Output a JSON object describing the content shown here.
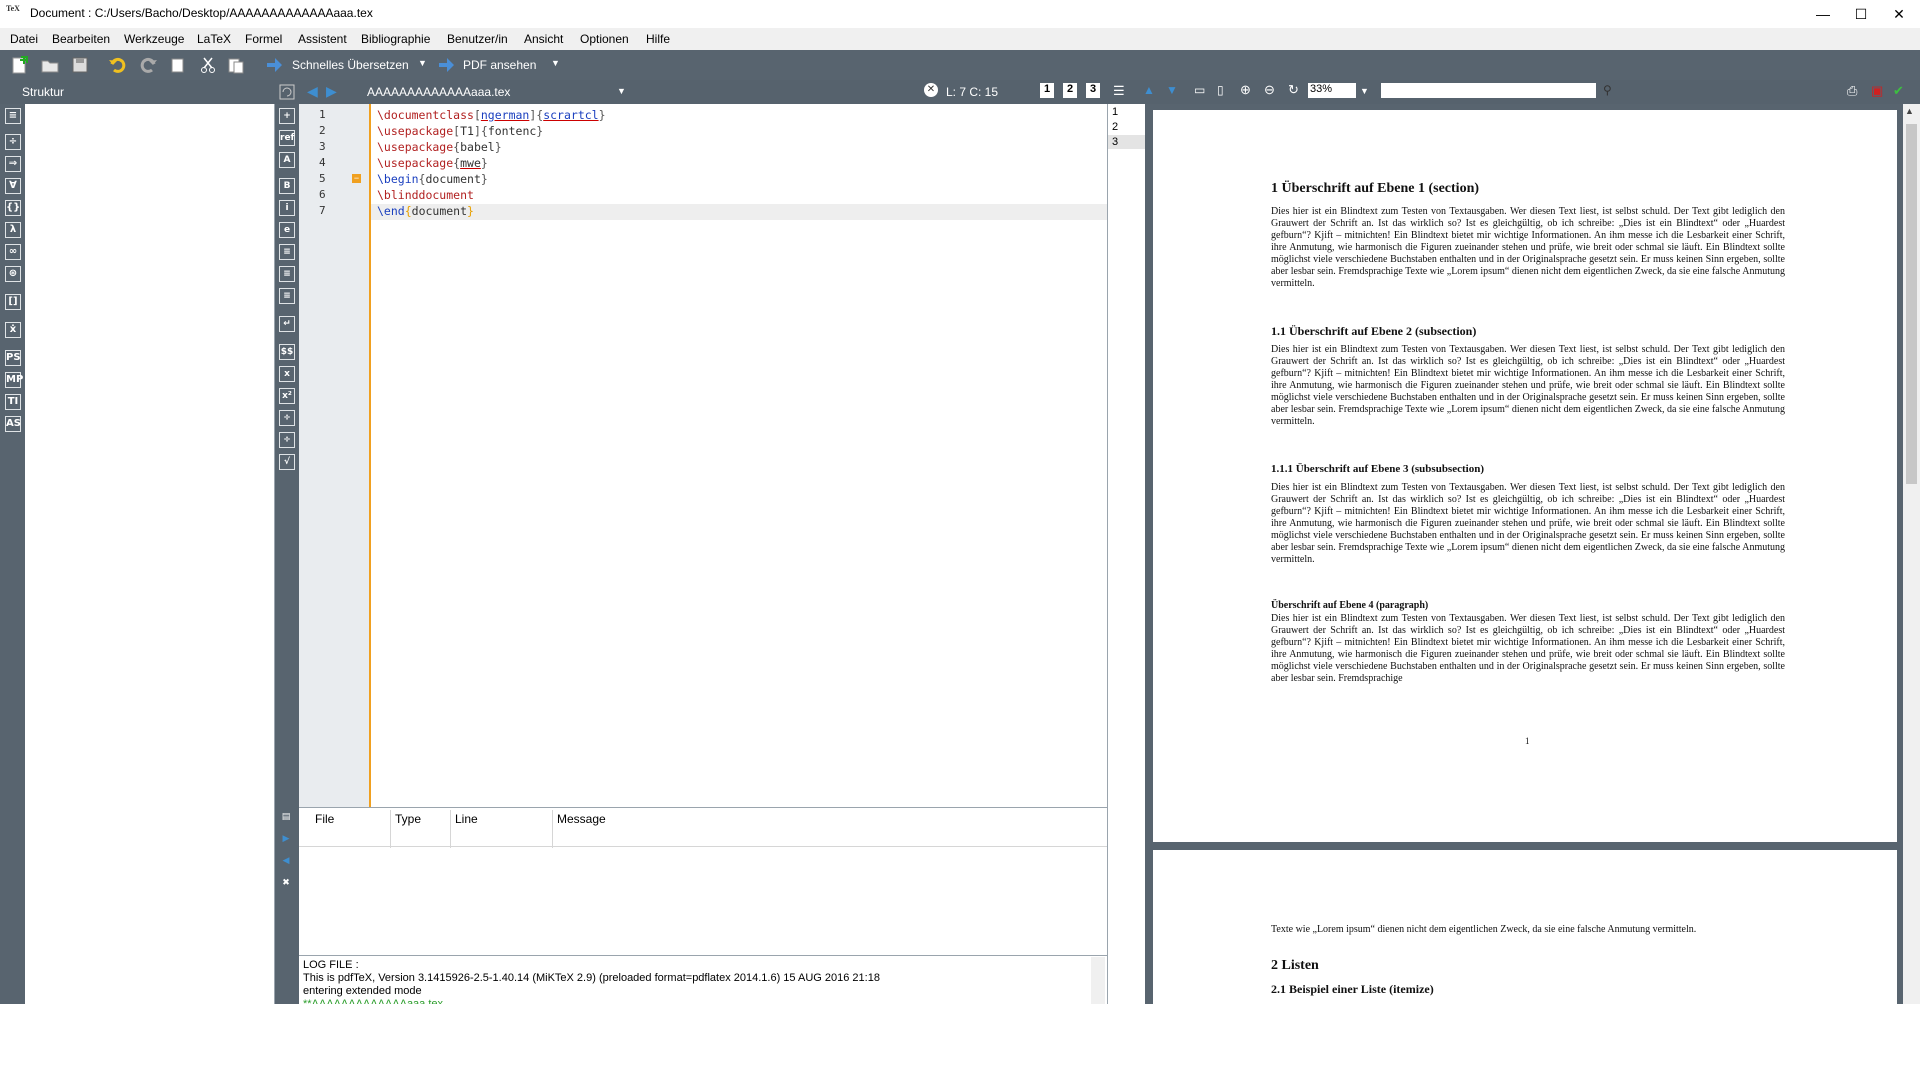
{
  "window": {
    "title": "Document : C:/Users/Bacho/Desktop/AAAAAAAAAAAAAaaa.tex",
    "app_icon_text": "TeX",
    "minimize": "—",
    "maximize": "☐",
    "close": "✕"
  },
  "menu": [
    "Datei",
    "Bearbeiten",
    "Werkzeuge",
    "LaTeX",
    "Formel",
    "Assistent",
    "Bibliographie",
    "Benutzer/in",
    "Ansicht",
    "Optionen",
    "Hilfe"
  ],
  "toolbar": {
    "quick_build": "Schnelles Übersetzen",
    "view_pdf": "PDF ansehen"
  },
  "structure": {
    "label": "Struktur"
  },
  "editor_tab": {
    "filename": "AAAAAAAAAAAAAaaa.tex",
    "cursor_pos": "L: 7 C: 15",
    "close": "✕"
  },
  "viewer_bar": {
    "zoom": "33%",
    "search_value": ""
  },
  "code": {
    "line_numbers": [
      "1",
      "2",
      "3",
      "4",
      "5",
      "6",
      "7"
    ],
    "l1_cmd": "\\documentclass",
    "l1_opt": "ngerman",
    "l1_arg": "scrartcl",
    "l2_cmd": "\\usepackage",
    "l2_opt": "T1",
    "l2_arg": "fontenc",
    "l3_cmd": "\\usepackage",
    "l3_arg": "babel",
    "l4_cmd": "\\usepackage",
    "l4_arg": "mwe",
    "l5_cmd": "\\begin",
    "l5_arg": "document",
    "l6_cmd": "\\blinddocument",
    "l7_cmd": "\\end",
    "l7_arg": "document",
    "fold_marker": "−"
  },
  "messages": {
    "columns": [
      "File",
      "Type",
      "Line",
      "Message"
    ]
  },
  "log": {
    "lines": [
      "LOG FILE :",
      "This is pdfTeX, Version 3.1415926-2.5-1.40.14 (MiKTeX 2.9) (preloaded format=pdflatex 2014.1.6) 15 AUG 2016 21:18",
      "entering extended mode",
      "**AAAAAAAAAAAAAaaa.tex"
    ]
  },
  "pages": {
    "list": [
      "1",
      "2",
      "3"
    ]
  },
  "pdf": {
    "h1": "1  Überschrift auf Ebene 1 (section)",
    "h2": "1.1  Überschrift auf Ebene 2 (subsection)",
    "h3": "1.1.1  Überschrift auf Ebene 3 (subsubsection)",
    "h4": "Überschrift auf Ebene 4 (paragraph)",
    "blind1": "Dies hier ist ein Blindtext zum Testen von Textausgaben. Wer diesen Text liest, ist selbst schuld. Der Text gibt lediglich den Grauwert der Schrift an. Ist das wirklich so? Ist es gleichgültig, ob ich schreibe: „Dies ist ein Blindtext“ oder „Huardest gefburn“? Kjift – mitnichten! Ein Blindtext bietet mir wichtige Informationen. An ihm messe ich die Lesbarkeit einer Schrift, ihre Anmutung, wie harmonisch die Figuren zueinander stehen und prüfe, wie breit oder schmal sie läuft. Ein Blindtext sollte möglichst viele verschiedene Buchstaben enthalten und in der Originalsprache gesetzt sein. Er muss keinen Sinn ergeben, sollte aber lesbar sein. Fremdsprachige Texte wie „Lorem ipsum“ dienen nicht dem eigentlichen Zweck, da sie eine falsche Anmutung vermitteln.",
    "blind4": "Dies hier ist ein Blindtext zum Testen von Textausgaben. Wer diesen Text liest, ist selbst schuld. Der Text gibt lediglich den Grauwert der Schrift an. Ist das wirklich so? Ist es gleichgültig, ob ich schreibe: „Dies ist ein Blindtext“ oder „Huardest gefburn“? Kjift – mitnichten! Ein Blindtext bietet mir wichtige Informationen. An ihm messe ich die Lesbarkeit einer Schrift, ihre Anmutung, wie harmonisch die Figuren zueinander stehen und prüfe, wie breit oder schmal sie läuft. Ein Blindtext sollte möglichst viele verschiedene Buchstaben enthalten und in der Originalsprache gesetzt sein. Er muss keinen Sinn ergeben, sollte aber lesbar sein. Fremdsprachige",
    "page_number": "1",
    "p2_text": "Texte wie „Lorem ipsum“ dienen nicht dem eigentlichen Zweck, da sie eine falsche Anmutung vermitteln.",
    "h_listen": "2  Listen",
    "h_itemize": "2.1  Beispiel einer Liste (itemize)"
  }
}
